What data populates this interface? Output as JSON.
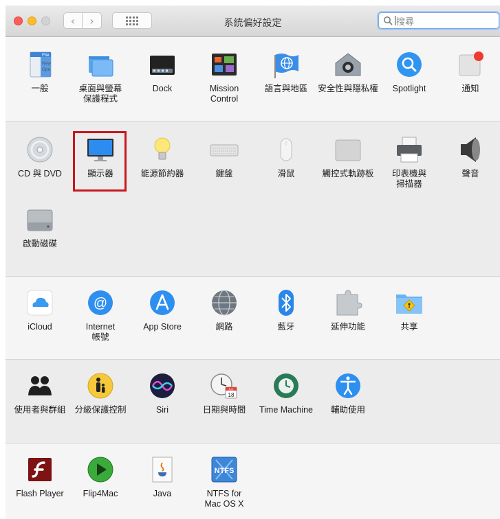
{
  "window": {
    "title": "系統偏好設定"
  },
  "toolbar": {
    "back_glyph": "‹",
    "forward_glyph": "›",
    "show_all_icon": "grid-icon"
  },
  "search": {
    "text": "搜尋",
    "icon": "search-icon"
  },
  "rows": [
    [
      {
        "id": "general",
        "label": "一般",
        "icon": "general-icon"
      },
      {
        "id": "desktop",
        "label": "桌面與螢幕\n保護程式",
        "icon": "desktop-screensaver-icon"
      },
      {
        "id": "dock",
        "label": "Dock",
        "icon": "dock-icon"
      },
      {
        "id": "mission",
        "label": "Mission\nControl",
        "icon": "mission-control-icon"
      },
      {
        "id": "language",
        "label": "語言與地區",
        "icon": "language-region-icon"
      },
      {
        "id": "security",
        "label": "安全性與隱私權",
        "icon": "security-privacy-icon"
      },
      {
        "id": "spotlight",
        "label": "Spotlight",
        "icon": "spotlight-icon"
      },
      {
        "id": "notifications",
        "label": "通知",
        "icon": "notifications-icon"
      }
    ],
    [
      {
        "id": "cddvd",
        "label": "CD 與 DVD",
        "icon": "cd-dvd-icon"
      },
      {
        "id": "displays",
        "label": "顯示器",
        "icon": "displays-icon",
        "highlighted": true
      },
      {
        "id": "energy",
        "label": "能源節約器",
        "icon": "energy-saver-icon"
      },
      {
        "id": "keyboard",
        "label": "鍵盤",
        "icon": "keyboard-icon"
      },
      {
        "id": "mouse",
        "label": "滑鼠",
        "icon": "mouse-icon"
      },
      {
        "id": "trackpad",
        "label": "觸控式軌跡板",
        "icon": "trackpad-icon"
      },
      {
        "id": "printers",
        "label": "印表機與\n掃描器",
        "icon": "printers-scanners-icon"
      },
      {
        "id": "sound",
        "label": "聲音",
        "icon": "sound-icon"
      },
      {
        "id": "startup",
        "label": "啟動磁碟",
        "icon": "startup-disk-icon"
      }
    ],
    [
      {
        "id": "icloud",
        "label": "iCloud",
        "icon": "icloud-icon"
      },
      {
        "id": "internet",
        "label": "Internet\n帳號",
        "icon": "internet-accounts-icon"
      },
      {
        "id": "appstore",
        "label": "App Store",
        "icon": "app-store-icon"
      },
      {
        "id": "network",
        "label": "網路",
        "icon": "network-icon"
      },
      {
        "id": "bluetooth",
        "label": "藍牙",
        "icon": "bluetooth-icon"
      },
      {
        "id": "extensions",
        "label": "延伸功能",
        "icon": "extensions-icon"
      },
      {
        "id": "sharing",
        "label": "共享",
        "icon": "sharing-icon"
      }
    ],
    [
      {
        "id": "users",
        "label": "使用者與群組",
        "icon": "users-groups-icon"
      },
      {
        "id": "parental",
        "label": "分級保護控制",
        "icon": "parental-controls-icon"
      },
      {
        "id": "siri",
        "label": "Siri",
        "icon": "siri-icon"
      },
      {
        "id": "datetime",
        "label": "日期與時間",
        "icon": "date-time-icon"
      },
      {
        "id": "timemachine",
        "label": "Time Machine",
        "icon": "time-machine-icon"
      },
      {
        "id": "accessibility",
        "label": "輔助使用",
        "icon": "accessibility-icon"
      }
    ],
    [
      {
        "id": "flash",
        "label": "Flash Player",
        "icon": "flash-player-icon"
      },
      {
        "id": "flip4mac",
        "label": "Flip4Mac",
        "icon": "flip4mac-icon"
      },
      {
        "id": "java",
        "label": "Java",
        "icon": "java-icon"
      },
      {
        "id": "ntfs",
        "label": "NTFS for\nMac OS X",
        "icon": "ntfs-icon"
      }
    ]
  ],
  "icon_text": {
    "general_lines": [
      "File",
      "New",
      "Ope"
    ],
    "calendar_month": "JUL",
    "calendar_day": "18",
    "ntfs": "NTFS",
    "at": "@"
  }
}
